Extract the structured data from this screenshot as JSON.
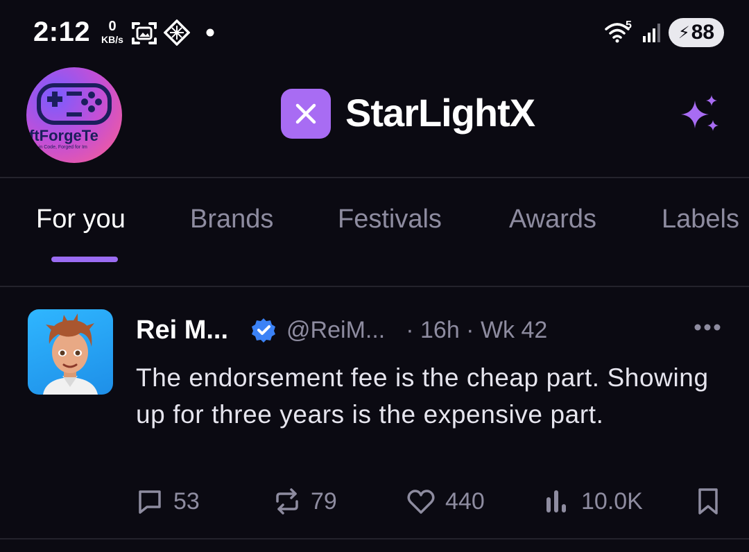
{
  "status_bar": {
    "time": "2:12",
    "net_speed_value": "0",
    "net_speed_unit": "KB/s",
    "battery": "88",
    "wifi_label": "5"
  },
  "header": {
    "brand_logo_text": "ftForgeTe",
    "brand_logo_subtext": "e in Code, Forged for Im",
    "app_title": "StarLightX"
  },
  "tabs": [
    {
      "label": "For you",
      "active": true
    },
    {
      "label": "Brands",
      "active": false
    },
    {
      "label": "Festivals",
      "active": false
    },
    {
      "label": "Awards",
      "active": false
    },
    {
      "label": "Labels",
      "active": false
    }
  ],
  "post": {
    "author": "Rei M...",
    "handle": "@ReiM...",
    "meta": "· 16h · Wk 42",
    "text": "The endorsement fee is the cheap part. Showing up for three years is the expensive part.",
    "replies": "53",
    "reposts": "79",
    "likes": "440",
    "views": "10.0K"
  },
  "colors": {
    "background": "#0b0a12",
    "accent": "#9b6cf2",
    "muted_text": "#8e8ca0",
    "verified": "#3b82f6"
  }
}
